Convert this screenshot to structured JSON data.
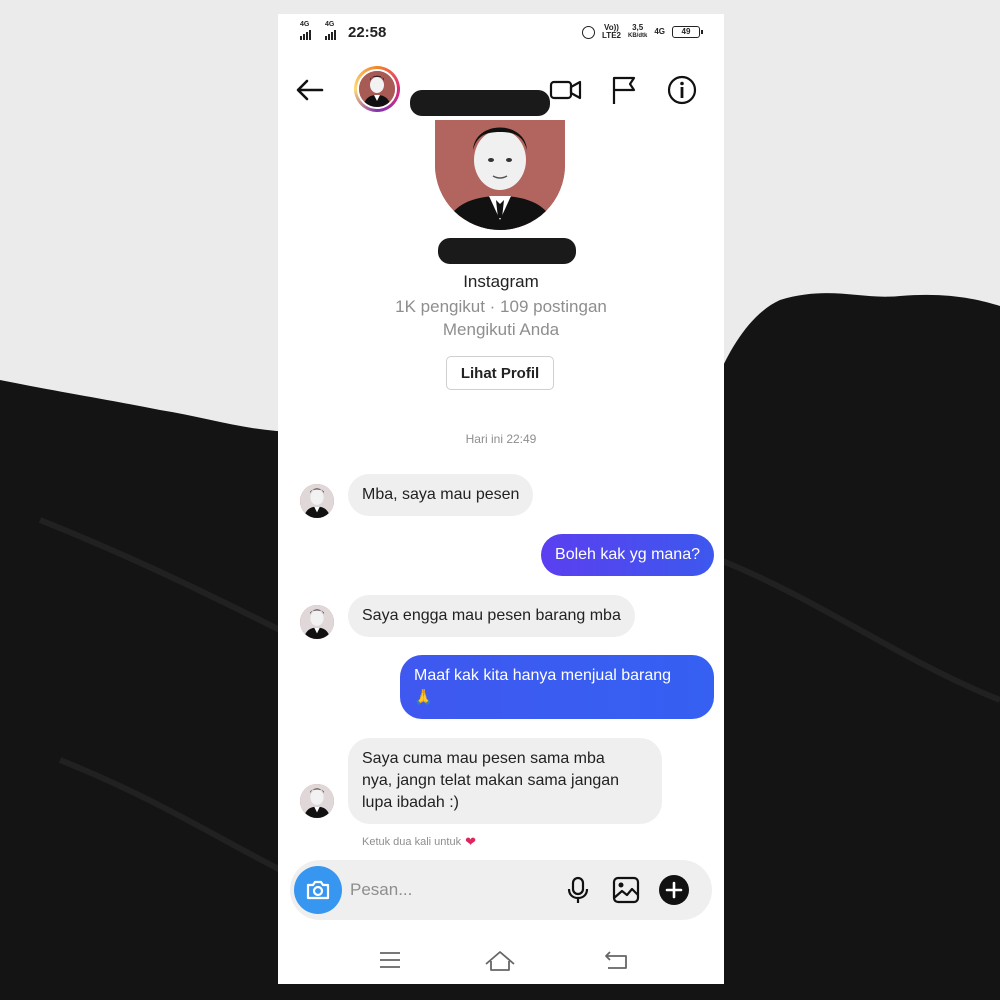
{
  "status_bar": {
    "time": "22:58",
    "sim1_network": "4G",
    "sim2_network": "4G",
    "volte": "Vo))",
    "lte": "LTE2",
    "speed_value": "3,5",
    "speed_unit": "KB/dtk",
    "net_right": "4G",
    "battery": "49"
  },
  "header": {
    "back_icon": "back-arrow-icon",
    "video_icon": "video-camera-icon",
    "flag_icon": "flag-icon",
    "info_icon": "info-icon"
  },
  "profile": {
    "app": "Instagram",
    "stats": "1K pengikut · 109 postingan",
    "follow_status": "Mengikuti Anda",
    "view_profile_label": "Lihat Profil"
  },
  "conversation": {
    "timestamp": "Hari ini 22:49",
    "messages": [
      {
        "from": "them",
        "text": "Mba, saya mau pesen"
      },
      {
        "from": "me",
        "text": "Boleh kak yg mana?"
      },
      {
        "from": "them",
        "text": "Saya engga mau pesen barang mba"
      },
      {
        "from": "me",
        "text": "Maaf kak kita hanya menjual barang",
        "emoji": "🙏"
      },
      {
        "from": "them",
        "lines": [
          "Saya cuma mau pesen sama mba",
          "nya, jangn telat makan sama jangan",
          "lupa ibadah :)"
        ]
      }
    ],
    "double_tap_hint": "Ketuk dua kali untuk",
    "heart": "❤"
  },
  "composer": {
    "placeholder": "Pesan...",
    "camera_icon": "camera-icon",
    "mic_icon": "microphone-icon",
    "gallery_icon": "image-icon",
    "plus_icon": "plus-icon"
  },
  "colors": {
    "outgoing_bubble_start": "#5b3ff0",
    "outgoing_bubble_end": "#3d58ee",
    "incoming_bubble": "#efefef",
    "camera_button": "#3797f0"
  }
}
